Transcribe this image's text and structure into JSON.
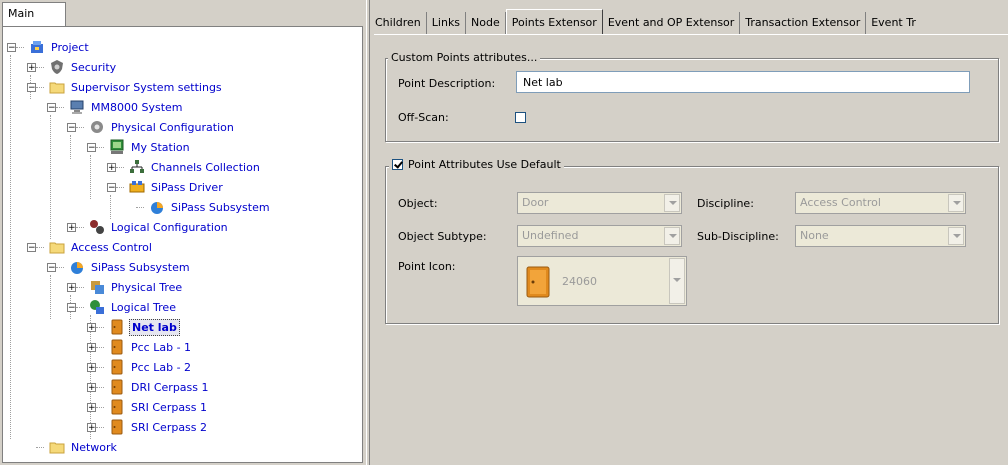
{
  "left": {
    "main_tab": "Main",
    "tree": [
      {
        "label": "Project",
        "icon": "project-icon",
        "exp": "minus"
      },
      {
        "label": "Security",
        "icon": "security-icon",
        "exp": "plus"
      },
      {
        "label": "Supervisor System settings",
        "icon": "folder-icon",
        "exp": "minus"
      },
      {
        "label": "MM8000 System",
        "icon": "computer-icon",
        "exp": "minus"
      },
      {
        "label": "Physical Configuration",
        "icon": "gear-icon",
        "exp": "minus"
      },
      {
        "label": "My Station",
        "icon": "station-icon",
        "exp": "minus"
      },
      {
        "label": "Channels Collection",
        "icon": "network-icon",
        "exp": "plus"
      },
      {
        "label": "SiPass Driver",
        "icon": "driver-icon",
        "exp": "minus"
      },
      {
        "label": "SiPass Subsystem",
        "icon": "subsystem-icon",
        "exp": ""
      },
      {
        "label": "Logical Configuration",
        "icon": "logical-icon",
        "exp": "plus"
      },
      {
        "label": "Access Control",
        "icon": "folder-icon",
        "exp": "minus"
      },
      {
        "label": "SiPass Subsystem",
        "icon": "subsystem-icon",
        "exp": "minus"
      },
      {
        "label": "Physical Tree",
        "icon": "physical-tree-icon",
        "exp": "plus"
      },
      {
        "label": "Logical Tree",
        "icon": "logical-tree-icon",
        "exp": "minus"
      },
      {
        "label": "Net lab",
        "icon": "door-icon",
        "exp": "plus",
        "selected": true
      },
      {
        "label": "Pcc Lab - 1",
        "icon": "door-icon",
        "exp": "plus"
      },
      {
        "label": "Pcc Lab - 2",
        "icon": "door-icon",
        "exp": "plus"
      },
      {
        "label": "DRI Cerpass 1",
        "icon": "door-icon",
        "exp": "plus"
      },
      {
        "label": "SRI Cerpass 1",
        "icon": "door-icon",
        "exp": "plus"
      },
      {
        "label": "SRI Cerpass 2",
        "icon": "door-icon",
        "exp": "plus"
      },
      {
        "label": "Network",
        "icon": "folder-icon",
        "exp": ""
      }
    ]
  },
  "tabs": [
    "Children",
    "Links",
    "Node",
    "Points Extensor",
    "Event and OP Extensor",
    "Transaction Extensor",
    "Event Tr"
  ],
  "active_tab": "Points Extensor",
  "custom": {
    "legend": "Custom Points attributes...",
    "point_description_label": "Point Description:",
    "point_description_value": "Net lab",
    "off_scan_label": "Off-Scan:",
    "off_scan_checked": false
  },
  "defaults": {
    "legend": "Point Attributes Use Default",
    "use_default_checked": true,
    "object_label": "Object:",
    "object_value": "Door",
    "discipline_label": "Discipline:",
    "discipline_value": "Access Control",
    "object_subtype_label": "Object Subtype:",
    "object_subtype_value": "Undefined",
    "sub_discipline_label": "Sub-Discipline:",
    "sub_discipline_value": "None",
    "point_icon_label": "Point Icon:",
    "point_icon_value": "24060"
  }
}
